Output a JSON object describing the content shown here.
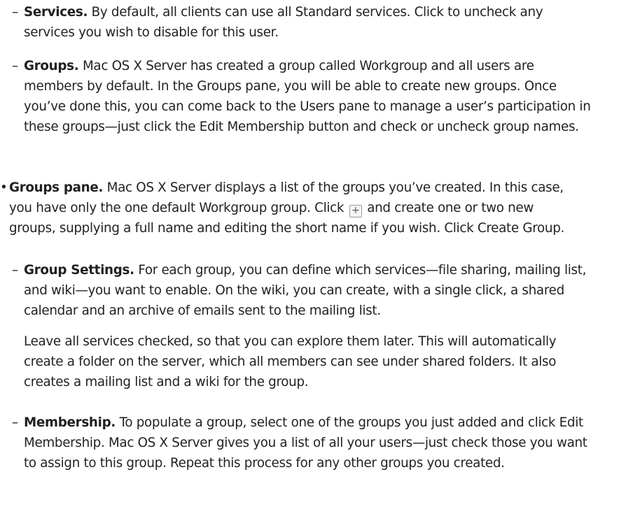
{
  "services": {
    "title": "Services.",
    "text": "By default, all clients can use all Standard services. Click to uncheck any services you wish to disable for this user."
  },
  "groups": {
    "title": "Groups.",
    "text": "Mac OS X Server has created a group called Workgroup and all users are members by default. In the Groups pane, you will be able to create new groups. Once you’ve done this, you can come back to the Users pane to manage a user’s participation in these groups—just click the Edit Membership button and check or uncheck group names."
  },
  "groups_pane": {
    "title": "Groups pane.",
    "text_before": "Mac OS X Server displays a list of the groups you’ve created. In this case, you have only the one default Workgroup group. Click",
    "add_glyph": "+",
    "text_after": "and create one or two new groups, supplying a full name and editing the short name if you wish. Click Create Group."
  },
  "group_settings": {
    "title": "Group Settings.",
    "text": "For each group, you can define which services—file sharing, mailing list, and wiki—you want to enable. On the wiki, you can create, with a single click, a shared calendar and an archive of emails sent to the mailing list.",
    "para2": "Leave all services checked, so that you can explore them later. This will automatically create a folder on the server, which all members can see under shared folders. It also creates a mailing list and a wiki for the group."
  },
  "membership": {
    "title": "Membership.",
    "text": "To populate a group, select one of the groups you just added and click Edit Membership. Mac OS X Server gives you a list of all your users—just check those you want to assign to this group. Repeat this process for any other groups you created."
  },
  "markers": {
    "dash": "–",
    "bullet": "•"
  }
}
